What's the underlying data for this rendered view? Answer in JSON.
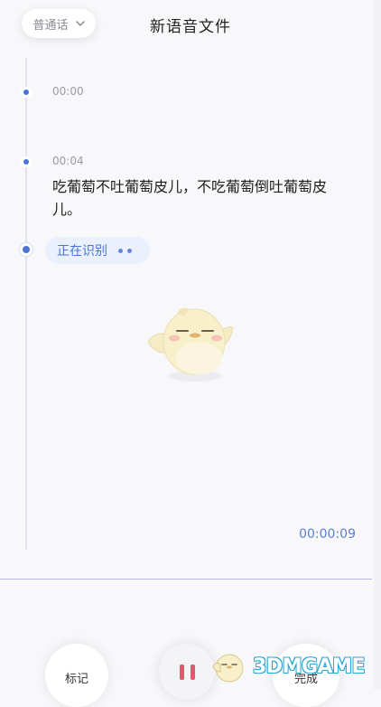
{
  "header": {
    "language": "普通话",
    "title": "新语音文件"
  },
  "timeline": {
    "entries": [
      {
        "timestamp": "00:00",
        "text": ""
      },
      {
        "timestamp": "00:04",
        "text": "吃葡萄不吐葡萄皮儿，不吃葡萄倒吐葡萄皮儿。"
      }
    ],
    "status": "正在识别"
  },
  "recording": {
    "elapsed": "00:00:09"
  },
  "controls": {
    "mark_label": "标记",
    "done_label": "完成"
  },
  "watermark": {
    "text": "3DMGAME"
  },
  "colors": {
    "accent": "#4a74d8",
    "pause": "#e9566b",
    "background": "#f8f8fb"
  }
}
